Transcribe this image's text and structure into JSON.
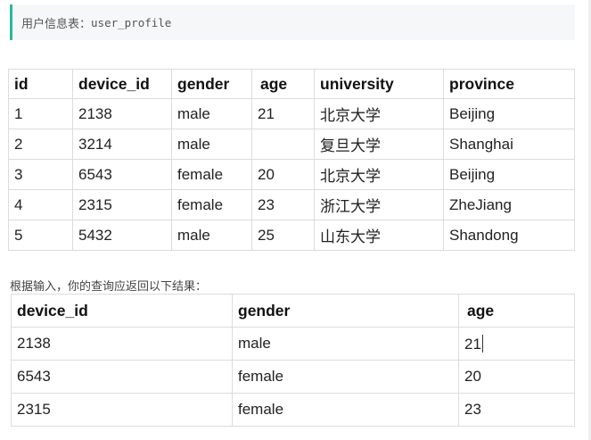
{
  "table_label": {
    "prefix": "用户信息表：",
    "name": "user_profile"
  },
  "profile_table": {
    "headers": [
      "id",
      "device_id",
      "gender",
      "age",
      "university",
      "province"
    ],
    "rows": [
      [
        "1",
        "2138",
        "male",
        "21",
        "北京大学",
        "Beijing"
      ],
      [
        "2",
        "3214",
        "male",
        "",
        "复旦大学",
        "Shanghai"
      ],
      [
        "3",
        "6543",
        "female",
        "20",
        "北京大学",
        "Beijing"
      ],
      [
        "4",
        "2315",
        "female",
        "23",
        "浙江大学",
        "ZheJiang"
      ],
      [
        "5",
        "5432",
        "male",
        "25",
        "山东大学",
        "Shandong"
      ]
    ]
  },
  "hint_text": "根据输入，你的查询应返回以下结果：",
  "result_table": {
    "headers": [
      "device_id",
      "gender",
      "age"
    ],
    "rows": [
      [
        "2138",
        "male",
        "21"
      ],
      [
        "6543",
        "female",
        "20"
      ],
      [
        "2315",
        "female",
        "23"
      ]
    ]
  },
  "colors": {
    "accent": "#25bb9b",
    "border": "#dcdcdc",
    "label_bg": "#f6f7f8"
  }
}
